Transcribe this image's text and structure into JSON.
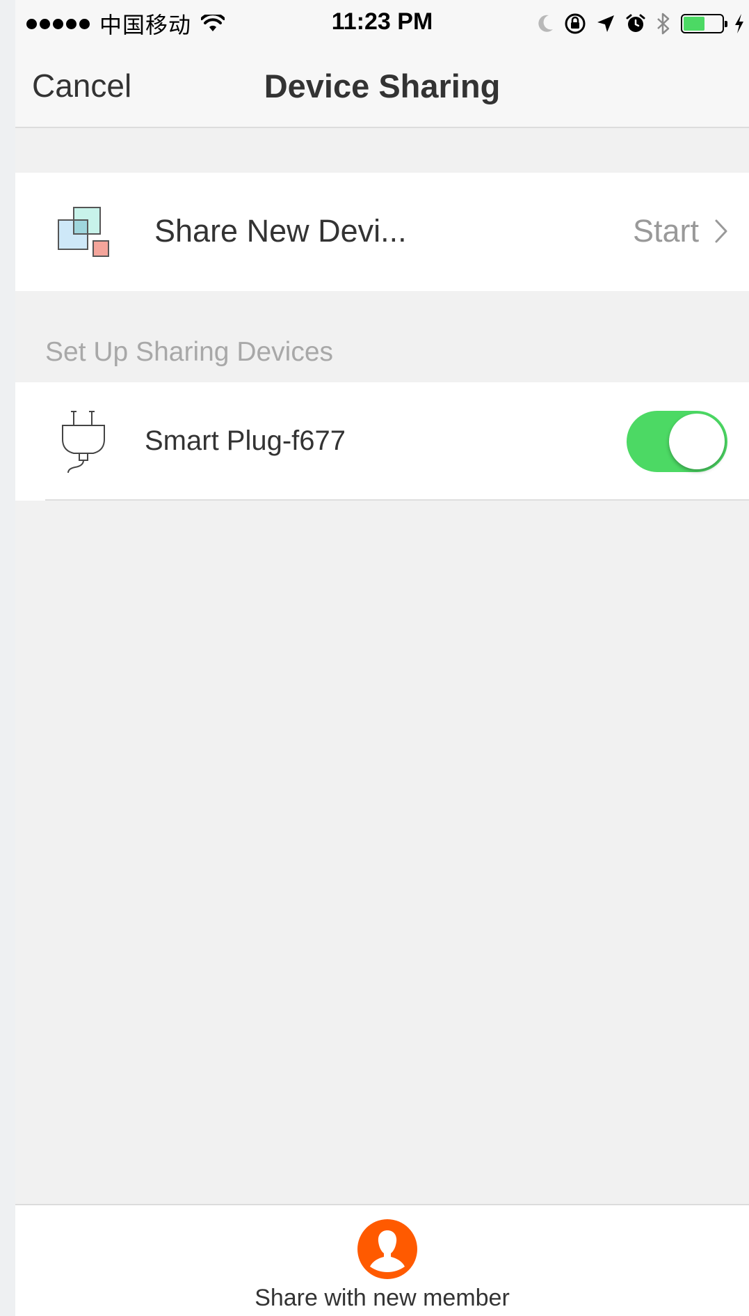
{
  "status_bar": {
    "carrier": "中国移动",
    "time": "11:23 PM",
    "battery_level": 0.55,
    "icons": [
      "signal-dots",
      "wifi-icon",
      "moon-icon",
      "rotation-lock-icon",
      "location-arrow-icon",
      "alarm-icon",
      "bluetooth-icon",
      "battery-icon",
      "charging-bolt-icon"
    ]
  },
  "nav": {
    "cancel_label": "Cancel",
    "title": "Device Sharing"
  },
  "share_new": {
    "label": "Share New Devi...",
    "action_label": "Start",
    "icon": "devices-icon"
  },
  "section": {
    "header": "Set Up Sharing Devices"
  },
  "devices": [
    {
      "name": "Smart Plug-f677",
      "icon": "plug-icon",
      "shared": true
    }
  ],
  "bottom": {
    "label": "Share with new member",
    "icon": "add-member-icon"
  },
  "colors": {
    "toggle_on": "#4cd964",
    "accent_orange": "#ff5a00",
    "section_text": "#a8a8a8",
    "background": "#f1f1f1"
  }
}
